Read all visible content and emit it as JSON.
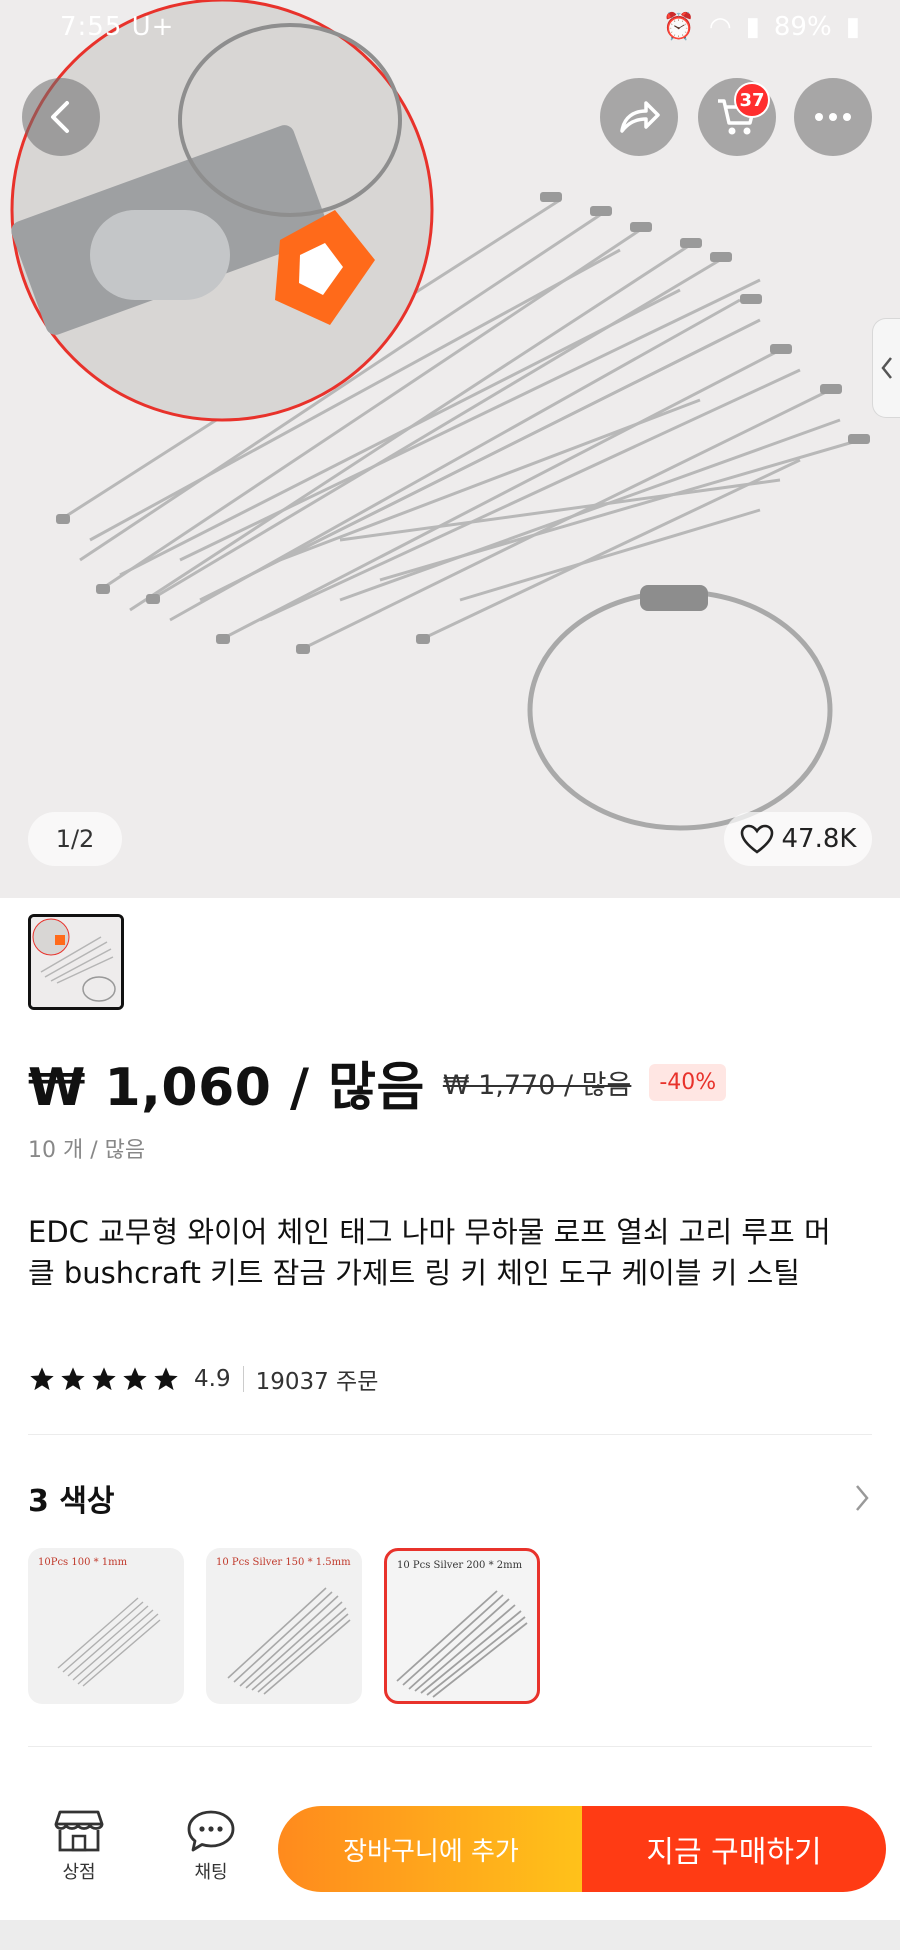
{
  "status_bar": {
    "time": "7:55",
    "carrier": "U+",
    "battery": "89%"
  },
  "header": {
    "cart_count": "37"
  },
  "gallery": {
    "page_indicator": "1/2",
    "wishlist_count": "47.8K"
  },
  "price": {
    "current": "₩ 1,060 / 많음",
    "original": "₩ 1,770 / 많음",
    "discount": "-40%",
    "unit_note": "10 개 / 많음"
  },
  "product": {
    "title": "EDC 교무형 와이어 체인 태그 나마 무하물 로프 열쇠 고리 루프 머클 bushcraft 키트 잠금 가제트 링 키 체인 도구 케이블 키 스틸",
    "rating": "4.9",
    "orders": "19037 주문"
  },
  "options": {
    "title": "3 색상",
    "variants": [
      {
        "label": "10Pcs 100 * 1mm"
      },
      {
        "label": "10 Pcs Silver 150 * 1.5mm"
      },
      {
        "label": "10 Pcs Silver 200 * 2mm"
      }
    ]
  },
  "bottom_bar": {
    "store_label": "상점",
    "chat_label": "채팅",
    "add_to_cart": "장바구니에 추가",
    "buy_now": "지금 구매하기"
  },
  "colors": {
    "accent_red": "#e8322b",
    "cart_orange": "#ff8a1d",
    "buy_red": "#ff3b14"
  },
  "icons": [
    "back-icon",
    "share-icon",
    "cart-icon",
    "more-icon",
    "heart-icon",
    "chevron-left-icon",
    "chevron-right-icon",
    "star-icon",
    "store-icon",
    "chat-icon"
  ]
}
